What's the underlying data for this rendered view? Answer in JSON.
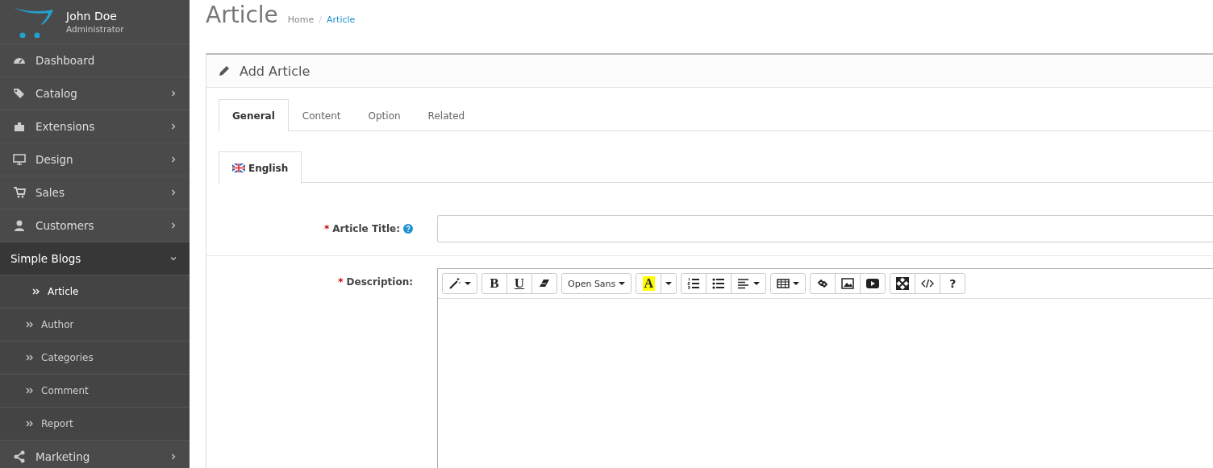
{
  "sidebar": {
    "user": {
      "name": "John Doe",
      "role": "Administrator"
    },
    "items": [
      {
        "label": "Dashboard",
        "kind": "link",
        "selected": false
      },
      {
        "label": "Catalog",
        "kind": "menu",
        "selected": false,
        "expanded": false
      },
      {
        "label": "Extensions",
        "kind": "menu",
        "selected": false,
        "expanded": false
      },
      {
        "label": "Design",
        "kind": "menu",
        "selected": false,
        "expanded": false
      },
      {
        "label": "Sales",
        "kind": "menu",
        "selected": false,
        "expanded": false
      },
      {
        "label": "Customers",
        "kind": "menu",
        "selected": false,
        "expanded": false
      },
      {
        "label": "Simple Blogs",
        "kind": "menu",
        "selected": true,
        "expanded": true,
        "children": [
          {
            "label": "Article",
            "selected": true
          },
          {
            "label": "Author",
            "selected": false
          },
          {
            "label": "Categories",
            "selected": false
          },
          {
            "label": "Comment",
            "selected": false
          },
          {
            "label": "Report",
            "selected": false
          }
        ]
      },
      {
        "label": "Marketing",
        "kind": "menu",
        "selected": false,
        "expanded": false
      }
    ]
  },
  "page": {
    "title": "Article",
    "breadcrumb_separator": "/",
    "breadcrumb": [
      {
        "label": "Home",
        "selected": false
      },
      {
        "label": "Article",
        "selected": true
      }
    ]
  },
  "panel": {
    "title": "Add Article",
    "tabs": [
      {
        "label": "General",
        "selected": true
      },
      {
        "label": "Content",
        "selected": false
      },
      {
        "label": "Option",
        "selected": false
      },
      {
        "label": "Related",
        "selected": false
      }
    ],
    "language_tabs": [
      {
        "label": "English",
        "selected": true
      }
    ],
    "fields": [
      {
        "label": "Article Title:",
        "required_mark": "*",
        "help": true
      },
      {
        "label": "Description:",
        "required_mark": "*",
        "help": false
      }
    ],
    "editor": {
      "toolbar": [
        [
          {
            "kind": "style"
          }
        ],
        [
          {
            "kind": "bold",
            "label": "B"
          },
          {
            "kind": "underline",
            "label": "U"
          },
          {
            "kind": "eraser"
          }
        ],
        [
          {
            "kind": "font",
            "label": "Open Sans"
          }
        ],
        [
          {
            "kind": "color",
            "label": "A"
          },
          {
            "kind": "caret"
          }
        ],
        [
          {
            "kind": "ol"
          },
          {
            "kind": "ul"
          },
          {
            "kind": "align"
          }
        ],
        [
          {
            "kind": "table"
          }
        ],
        [
          {
            "kind": "link"
          },
          {
            "kind": "picture"
          },
          {
            "kind": "video"
          }
        ],
        [
          {
            "kind": "fullscreen"
          },
          {
            "kind": "code"
          },
          {
            "kind": "help",
            "label": "?"
          }
        ]
      ]
    }
  }
}
